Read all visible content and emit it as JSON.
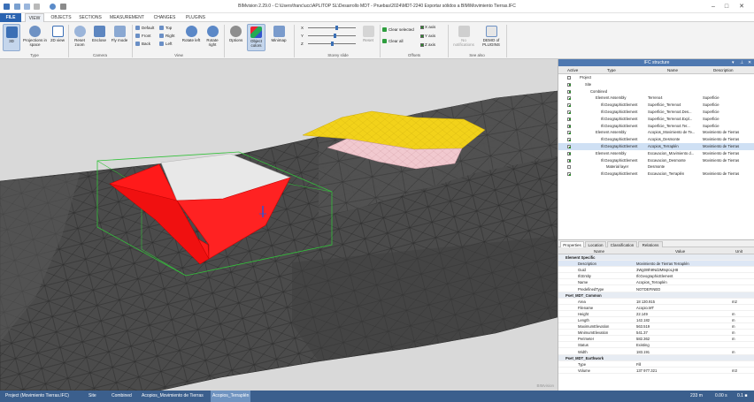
{
  "app": {
    "title": "BIMvision 2.29.0 - C:\\Users\\franc\\ucc\\APLITOP SL\\Desarrollo MDT - Pruebas\\2024\\MDT-2240 Exportar sólidos a BIM\\Movimiento Tierras.IFC"
  },
  "tabs": [
    "FILE",
    "VIEW",
    "OBJECTS",
    "SECTIONS",
    "MEASUREMENT",
    "CHANGES",
    "PLUGINS"
  ],
  "ribbon": {
    "type_buttons": [
      "3D",
      "Projections in space",
      "2D view"
    ],
    "camera_buttons": [
      "Reset zoom",
      "Enclose",
      "Fly mode"
    ],
    "view_small": [
      "Default",
      "Top",
      "Front",
      "Right",
      "Back",
      "Left"
    ],
    "rotate_buttons": [
      "Rotate left",
      "Rotate right"
    ],
    "options_buttons": [
      "Options",
      "Object colors",
      "Minimap"
    ],
    "storey": {
      "axes": [
        "X",
        "Y",
        "Z"
      ],
      "reset": "Reset",
      "levels": [
        0.6,
        0.55,
        0.5
      ]
    },
    "offsets": {
      "clear_selected": "Clear selected",
      "clear_all": "Clear all",
      "axes": [
        "X axis",
        "Y axis",
        "Z axis"
      ]
    },
    "see_also": {
      "notifications": "No notifications",
      "demo": "DEMO of PLUGINS"
    },
    "groups": [
      "Type",
      "Camera",
      "View",
      "Storey slide",
      "Offsets",
      "See also"
    ]
  },
  "ifc_panel": {
    "title": "IFC structure",
    "columns": [
      "Active",
      "Type",
      "Name",
      "Description"
    ],
    "rows": [
      {
        "level": 0,
        "checked": false,
        "type": "Project",
        "name": "",
        "desc": ""
      },
      {
        "level": 1,
        "checked": true,
        "type": "Site",
        "name": "",
        "desc": ""
      },
      {
        "level": 2,
        "checked": true,
        "type": "Combined",
        "name": "",
        "desc": ""
      },
      {
        "level": 3,
        "checked": true,
        "type": "Element Assembly",
        "name": "Terreno4",
        "desc": "Superficie"
      },
      {
        "level": 4,
        "checked": true,
        "type": "IfcGeographicElement",
        "name": "Superficie_Terreno4",
        "desc": "Superficie"
      },
      {
        "level": 4,
        "checked": true,
        "type": "IfcGeographicElement",
        "name": "Superficie_Terreno4.Des...",
        "desc": "Superficie"
      },
      {
        "level": 4,
        "checked": true,
        "type": "IfcGeographicElement",
        "name": "Superficie_Terreno4.Expl...",
        "desc": "Superficie"
      },
      {
        "level": 4,
        "checked": true,
        "type": "IfcGeographicElement",
        "name": "Superficie_Terreno4.Ter...",
        "desc": "Superficie"
      },
      {
        "level": 3,
        "checked": true,
        "type": "Element Assembly",
        "name": "Acopios_Movimiento de Te...",
        "desc": "Movimiento de Tierras"
      },
      {
        "level": 4,
        "checked": true,
        "type": "IfcGeographicElement",
        "name": "Acopios_Desmonte",
        "desc": "Movimiento de Tierras"
      },
      {
        "level": 4,
        "checked": true,
        "type": "IfcGeographicElement",
        "name": "Acopios_Terraplén",
        "desc": "Movimiento de Tierras",
        "selected": true
      },
      {
        "level": 3,
        "checked": true,
        "type": "Element Assembly",
        "name": "Excavacion_Movimiento d...",
        "desc": "Movimiento de Tierras"
      },
      {
        "level": 4,
        "checked": true,
        "type": "IfcGeographicElement",
        "name": "Excavacion_Desmonte",
        "desc": "Movimiento de Tierras"
      },
      {
        "level": 5,
        "checked": false,
        "type": "Material layer",
        "name": "Desmonte",
        "desc": ""
      },
      {
        "level": 4,
        "checked": true,
        "type": "IfcGeographicElement",
        "name": "Excavacion_Terraplén",
        "desc": "Movimiento de Tierras"
      }
    ]
  },
  "props": {
    "tabs": [
      "Properties",
      "Location",
      "Classification",
      "Relations"
    ],
    "columns": [
      "Name",
      "Value",
      "Unit"
    ],
    "rows": [
      {
        "section": true,
        "name": "Element Specific"
      },
      {
        "name": "Description",
        "value": "Movimiento de Tierras Terraplén",
        "unit": ""
      },
      {
        "name": "Guid",
        "value": "3Wg0I9h9Nd2M9qroLjH8",
        "unit": ""
      },
      {
        "name": "IfcEntity",
        "value": "IfcGeographicElement",
        "unit": ""
      },
      {
        "name": "Name",
        "value": "Acopios_Terraplén",
        "unit": ""
      },
      {
        "name": "PredefinedType",
        "value": "NOTDEFINED",
        "unit": ""
      },
      {
        "section": true,
        "name": "Pset_MDT_Common"
      },
      {
        "name": "Area",
        "value": "18 130.915",
        "unit": "m2"
      },
      {
        "name": "Filename",
        "value": "Acopio.MT",
        "unit": ""
      },
      {
        "name": "Height",
        "value": "22.149",
        "unit": "m"
      },
      {
        "name": "Length",
        "value": "142.182",
        "unit": "m"
      },
      {
        "name": "MaximumElevation",
        "value": "563.519",
        "unit": "m"
      },
      {
        "name": "MinimumElevation",
        "value": "541.37",
        "unit": "m"
      },
      {
        "name": "Perimeter",
        "value": "582.362",
        "unit": "m"
      },
      {
        "name": "Status",
        "value": "Existing",
        "unit": ""
      },
      {
        "name": "Width",
        "value": "183.191",
        "unit": "m"
      },
      {
        "section": true,
        "name": "Pset_MDT_Earthwork"
      },
      {
        "name": "Type",
        "value": "Fill",
        "unit": ""
      },
      {
        "name": "Volume",
        "value": "137 977.321",
        "unit": "m3"
      }
    ]
  },
  "viewport": {
    "watermark": "BIMvision"
  },
  "status": {
    "crumbs": [
      "Project (Movimiento Tierras.IFC)",
      "Site",
      "Combined",
      "Acopios_Movimiento de Tierras",
      "Acopios_Terraplén"
    ],
    "scale": "233 m",
    "time": "0.00 s",
    "fps": "0.1 ■"
  },
  "colors": {
    "accent": "#2a63b0",
    "status_bar": "#3b5f8d",
    "selected_solid": "#ff1a1a",
    "fill_solid": "#f2d21a",
    "pink_solid": "#f1c9cf",
    "terrain": "#4a4a4a"
  }
}
